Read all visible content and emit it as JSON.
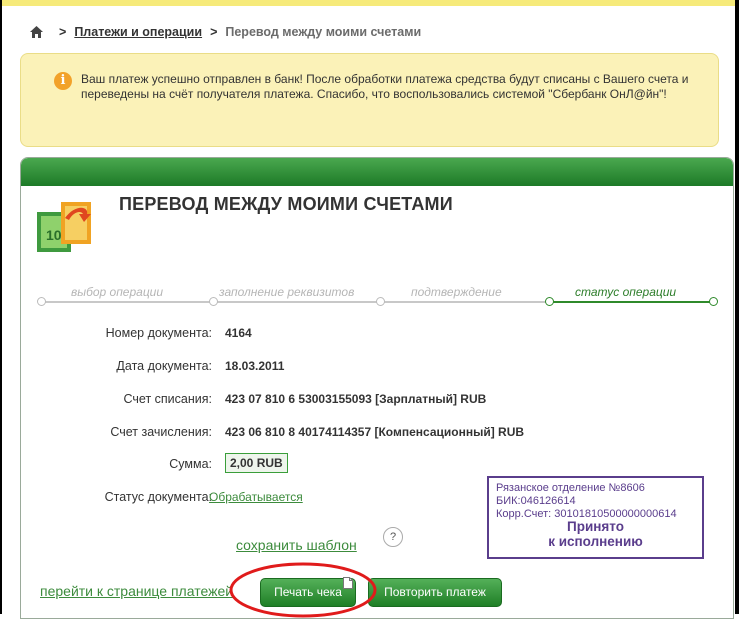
{
  "breadcrumb": {
    "home_icon": "home-icon",
    "link": "Платежи и операции",
    "current": "Перевод между моими счетами"
  },
  "notice": {
    "icon": "info-icon",
    "text": "Ваш платеж успешно отправлен в банк! После обработки платежа средства будут списаны с Вашего счета и переведены на счёт получателя платежа. Спасибо, что воспользовались системой \"Сбербанк ОнЛ@йн\"!"
  },
  "panel": {
    "title": "ПЕРЕВОД МЕЖДУ МОИМИ СЧЕТАМИ",
    "steps": [
      {
        "label": "выбор операции",
        "active": false
      },
      {
        "label": "заполнение реквизитов",
        "active": false
      },
      {
        "label": "подтверждение",
        "active": false
      },
      {
        "label": "статус операции",
        "active": true
      }
    ],
    "fields": {
      "doc_number": {
        "label": "Номер документа:",
        "value": "4164"
      },
      "doc_date": {
        "label": "Дата документа:",
        "value": "18.03.2011"
      },
      "debit_account": {
        "label": "Счет списания:",
        "value": "423 07 810 6 53003155093 [Зарплатный] RUB"
      },
      "credit_account": {
        "label": "Счет зачисления:",
        "value": "423 06 810 8 40174114357 [Компенсационный] RUB"
      },
      "amount": {
        "label": "Сумма:",
        "value": "2,00 RUB"
      },
      "status": {
        "label": "Статус документа:",
        "value": "Обрабатывается"
      }
    },
    "stamp": {
      "line1": "Рязанское отделение №8606",
      "line2": "БИК:046126614",
      "line3": "Корр.Счет: 30101810500000000614",
      "line4": "Принято",
      "line5": "к исполнению"
    },
    "save_template": "сохранить шаблон",
    "help": "?",
    "goto_payments": "перейти к странице платежей",
    "print_button": "Печать чека",
    "repeat_button": "Повторить платеж"
  },
  "colors": {
    "header_green": "#1d7a27",
    "notice_bg": "#fbf2b8",
    "link_green": "#3c8b3c",
    "stamp_purple": "#5a3d8c",
    "highlight_red": "#e01b1b"
  }
}
